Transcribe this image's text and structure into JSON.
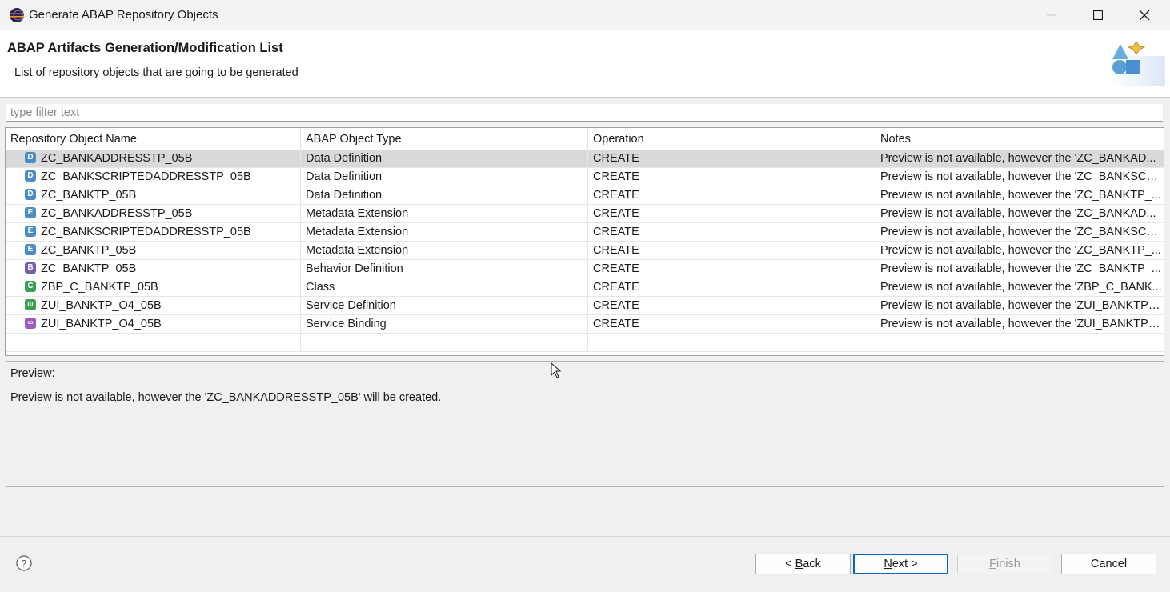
{
  "window": {
    "title": "Generate ABAP Repository Objects"
  },
  "header": {
    "title": "ABAP Artifacts Generation/Modification List",
    "description": "List of repository objects that are going to be generated"
  },
  "filter": {
    "placeholder": "type filter text",
    "value": ""
  },
  "table": {
    "columns": [
      "Repository Object Name",
      "ABAP Object Type",
      "Operation",
      "Notes"
    ],
    "rows": [
      {
        "icon": "data-definition-icon",
        "icon_letter": "D",
        "icon_color": "#4a8cc8",
        "name": "ZC_BANKADDRESSTP_05B",
        "type": "Data Definition",
        "operation": "CREATE",
        "notes": "Preview is not available, however the 'ZC_BANKAD...",
        "selected": true
      },
      {
        "icon": "data-definition-icon",
        "icon_letter": "D",
        "icon_color": "#4a8cc8",
        "name": "ZC_BANKSCRIPTEDADDRESSTP_05B",
        "type": "Data Definition",
        "operation": "CREATE",
        "notes": "Preview is not available, however the 'ZC_BANKSCR..."
      },
      {
        "icon": "data-definition-icon",
        "icon_letter": "D",
        "icon_color": "#4a8cc8",
        "name": "ZC_BANKTP_05B",
        "type": "Data Definition",
        "operation": "CREATE",
        "notes": "Preview is not available, however the 'ZC_BANKTP_..."
      },
      {
        "icon": "metadata-extension-icon",
        "icon_letter": "E",
        "icon_color": "#4a8cc8",
        "name": "ZC_BANKADDRESSTP_05B",
        "type": "Metadata Extension",
        "operation": "CREATE",
        "notes": "Preview is not available, however the 'ZC_BANKAD..."
      },
      {
        "icon": "metadata-extension-icon",
        "icon_letter": "E",
        "icon_color": "#4a8cc8",
        "name": "ZC_BANKSCRIPTEDADDRESSTP_05B",
        "type": "Metadata Extension",
        "operation": "CREATE",
        "notes": "Preview is not available, however the 'ZC_BANKSCR..."
      },
      {
        "icon": "metadata-extension-icon",
        "icon_letter": "E",
        "icon_color": "#4a8cc8",
        "name": "ZC_BANKTP_05B",
        "type": "Metadata Extension",
        "operation": "CREATE",
        "notes": "Preview is not available, however the 'ZC_BANKTP_..."
      },
      {
        "icon": "behavior-definition-icon",
        "icon_letter": "B",
        "icon_color": "#7a5cae",
        "name": "ZC_BANKTP_05B",
        "type": "Behavior Definition",
        "operation": "CREATE",
        "notes": "Preview is not available, however the 'ZC_BANKTP_..."
      },
      {
        "icon": "class-icon",
        "icon_letter": "C",
        "icon_color": "#3aa050",
        "name": "ZBP_C_BANKTP_05B",
        "type": "Class",
        "operation": "CREATE",
        "notes": "Preview is not available, however the 'ZBP_C_BANK..."
      },
      {
        "icon": "service-definition-icon",
        "icon_letter": "⊙",
        "icon_color": "#3aa050",
        "name": "ZUI_BANKTP_O4_05B",
        "type": "Service Definition",
        "operation": "CREATE",
        "notes": "Preview is not available, however the 'ZUI_BANKTP_..."
      },
      {
        "icon": "service-binding-icon",
        "icon_letter": "∞",
        "icon_color": "#9a5cc0",
        "name": "ZUI_BANKTP_O4_05B",
        "type": "Service Binding",
        "operation": "CREATE",
        "notes": "Preview is not available, however the 'ZUI_BANKTP_..."
      }
    ]
  },
  "preview": {
    "label": "Preview:",
    "text": "Preview is not available, however the 'ZC_BANKADDRESSTP_05B' will be created."
  },
  "buttons": {
    "back_prefix": "< ",
    "back_mnemonic": "B",
    "back_rest": "ack",
    "next_mnemonic": "N",
    "next_rest": "ext >",
    "finish_mnemonic": "F",
    "finish_rest": "inish",
    "cancel": "Cancel"
  },
  "colors": {
    "selected_row": "#d9d9d9",
    "default_button_border": "#0067c0"
  }
}
